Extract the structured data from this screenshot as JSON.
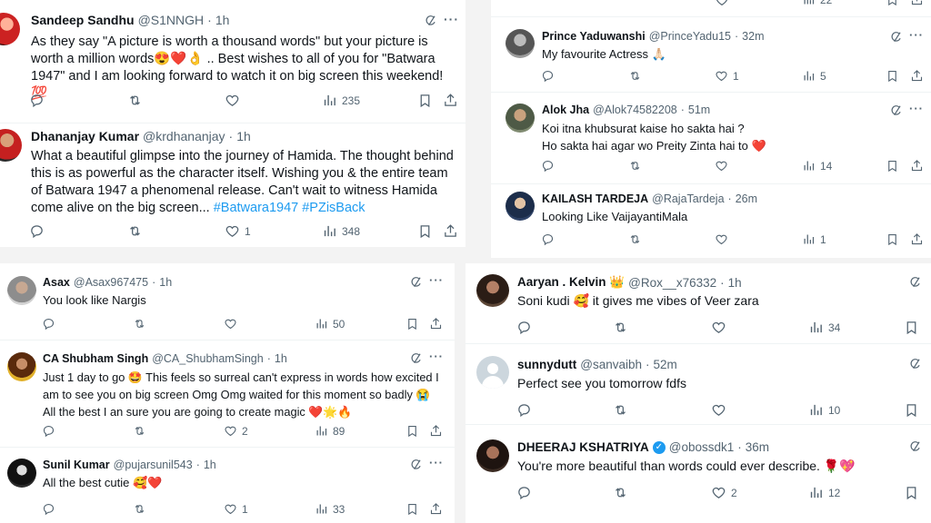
{
  "panel1": [
    {
      "name": "Sandeep Sandhu",
      "handle": "@S1NNGH",
      "time": "1h",
      "text": "As they say \"A picture is worth a thousand words\" but your picture is worth a million words😍❤️👌 .. Best wishes to all of you for \"Batwara 1947\" and I am looking forward to watch it on big screen this weekend!💯",
      "replies": "",
      "retweets": "",
      "likes": "",
      "views": "235"
    },
    {
      "name": "Dhananjay Kumar",
      "handle": "@krdhananjay",
      "time": "1h",
      "text": "What a beautiful glimpse into the journey of Hamida. The thought behind this is as powerful as the character itself. Wishing you & the entire team of Batwara 1947 a phenomenal release. Can't wait to witness Hamida come alive on the big screen... ",
      "hashtags": "#Batwara1947 #PZisBack",
      "replies": "",
      "retweets": "",
      "likes": "1",
      "views": "348"
    }
  ],
  "panel2_top_views": "22",
  "panel2": [
    {
      "name": "Prince Yaduwanshi",
      "handle": "@PrinceYadu15",
      "time": "32m",
      "text": "My favourite Actress 🙏🏻",
      "likes": "1",
      "views": "5"
    },
    {
      "name": "Alok Jha",
      "handle": "@Alok74582208",
      "time": "51m",
      "text": "Koi itna khubsurat kaise ho sakta hai ?\nHo sakta hai agar wo Preity Zinta hai to ❤️",
      "likes": "",
      "views": "14"
    },
    {
      "name": "KAILASH TARDEJA",
      "handle": "@RajaTardeja",
      "time": "26m",
      "text": "Looking Like VaijayantiMala",
      "likes": "",
      "views": "1"
    }
  ],
  "panel3": [
    {
      "name": "Asax",
      "handle": "@Asax967475",
      "time": "1h",
      "text": "You look like Nargis",
      "likes": "",
      "views": "50"
    },
    {
      "name": "CA Shubham Singh",
      "handle": "@CA_ShubhamSingh",
      "time": "1h",
      "text": "Just 1 day to go 🤩 This feels so surreal can't express in words how excited I am to see you on big screen Omg Omg waited for this moment so badly 😭\nAll the best I an sure you are going to create magic ❤️🌟🔥",
      "likes": "2",
      "views": "89"
    },
    {
      "name": "Sunil Kumar",
      "handle": "@pujarsunil543",
      "time": "1h",
      "text": "All the best cutie 🥰❤️",
      "likes": "1",
      "views": "33"
    }
  ],
  "panel4": [
    {
      "name": "Aaryan . Kelvin 👑",
      "handle": "@Rox__x76332",
      "time": "1h",
      "text": "Soni kudi 🥰 it gives me vibes of Veer zara",
      "likes": "",
      "views": "34"
    },
    {
      "name": "sunnydutt",
      "handle": "@sanvaibh",
      "time": "52m",
      "text": "Perfect see you tomorrow fdfs",
      "likes": "",
      "views": "10"
    },
    {
      "name": "DHEERAJ KSHATRIYA",
      "handle": "@obossdk1",
      "time": "36m",
      "verified": true,
      "text": "You're more beautiful than words could ever describe. 🌹💖",
      "likes": "2",
      "views": "12"
    }
  ],
  "colors": {
    "accent": "#1d9bf0",
    "muted": "#536471"
  }
}
